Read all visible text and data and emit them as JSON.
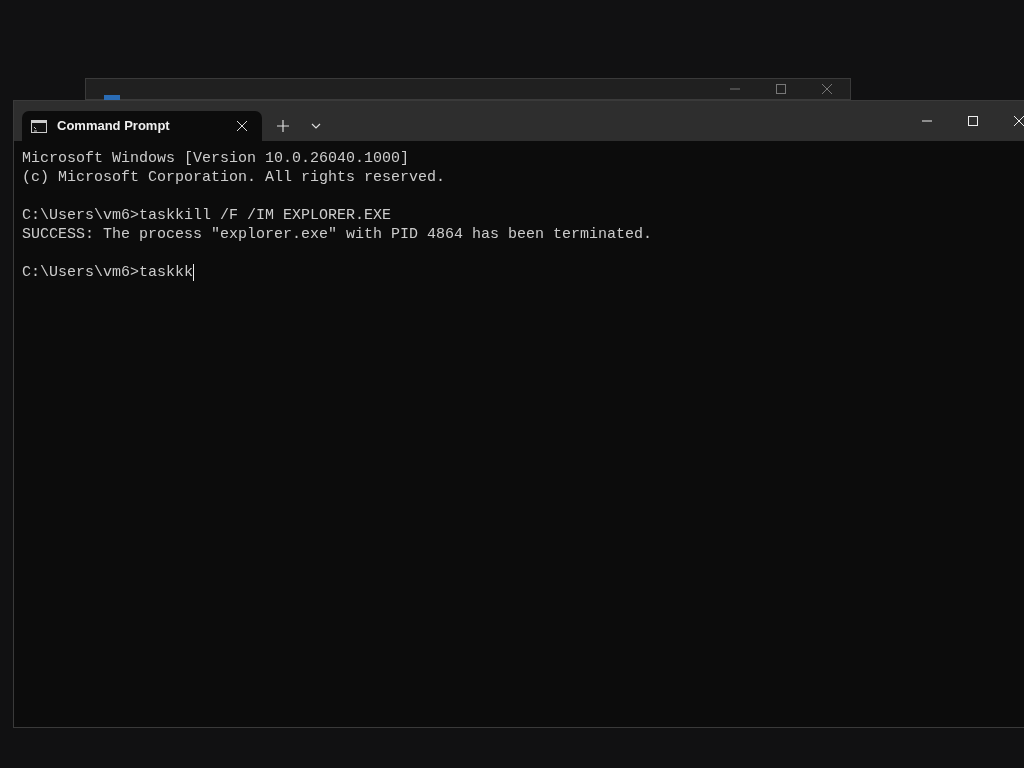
{
  "background_window": {
    "caption_buttons": [
      {
        "kind": "minimize"
      },
      {
        "kind": "maximize"
      },
      {
        "kind": "close"
      }
    ]
  },
  "window": {
    "tabs": [
      {
        "title": "Command Prompt",
        "selected": true
      }
    ],
    "caption_buttons": [
      {
        "kind": "minimize"
      },
      {
        "kind": "maximize"
      },
      {
        "kind": "close"
      }
    ]
  },
  "terminal": {
    "blocks": [
      {
        "lines": [
          {
            "text": "Microsoft Windows [Version 10.0.26040.1000]",
            "cursor": false
          },
          {
            "text": "(c) Microsoft Corporation. All rights reserved.",
            "cursor": false
          }
        ]
      },
      {
        "lines": [
          {
            "text": "C:\\Users\\vm6>taskkill /F /IM EXPLORER.EXE",
            "cursor": false
          },
          {
            "text": "SUCCESS: The process \"explorer.exe\" with PID 4864 has been terminated.",
            "cursor": false
          }
        ]
      },
      {
        "lines": [
          {
            "text": "C:\\Users\\vm6>taskkk",
            "cursor": true
          }
        ]
      }
    ]
  }
}
